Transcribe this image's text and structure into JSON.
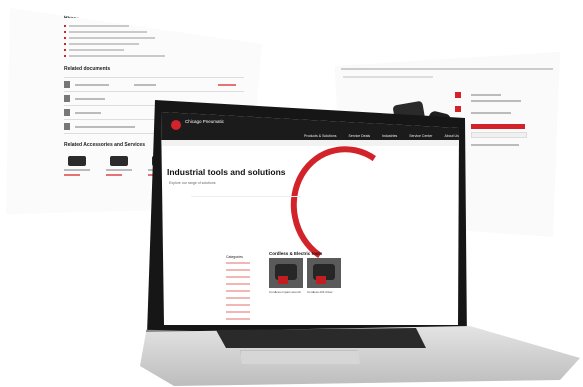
{
  "left_panel": {
    "benefits_heading": "Benefits",
    "related_documents_heading": "Related documents",
    "related_accessories_heading": "Related Accessories and Services",
    "document_rows": 4,
    "accessory_cards": 3
  },
  "laptop_site": {
    "logo_text": "Chicago Pneumatic",
    "nav": [
      "Products & Solutions",
      "Service Deals",
      "Industries",
      "Service Center",
      "About Us"
    ],
    "hero_title": "Industrial tools and solutions",
    "hero_subtitle": "Explore our range of solutions",
    "section_title": "Cordless & Electric tools",
    "sidebar_title": "Categories",
    "sidebar_items": 9,
    "product_cards": [
      {
        "label": "Cordless impact wrench"
      },
      {
        "label": "Cordless drill driver"
      }
    ]
  },
  "colors": {
    "brand_red": "#d2232a",
    "header_dark": "#1b1b1b",
    "laptop_body": "#161616"
  }
}
